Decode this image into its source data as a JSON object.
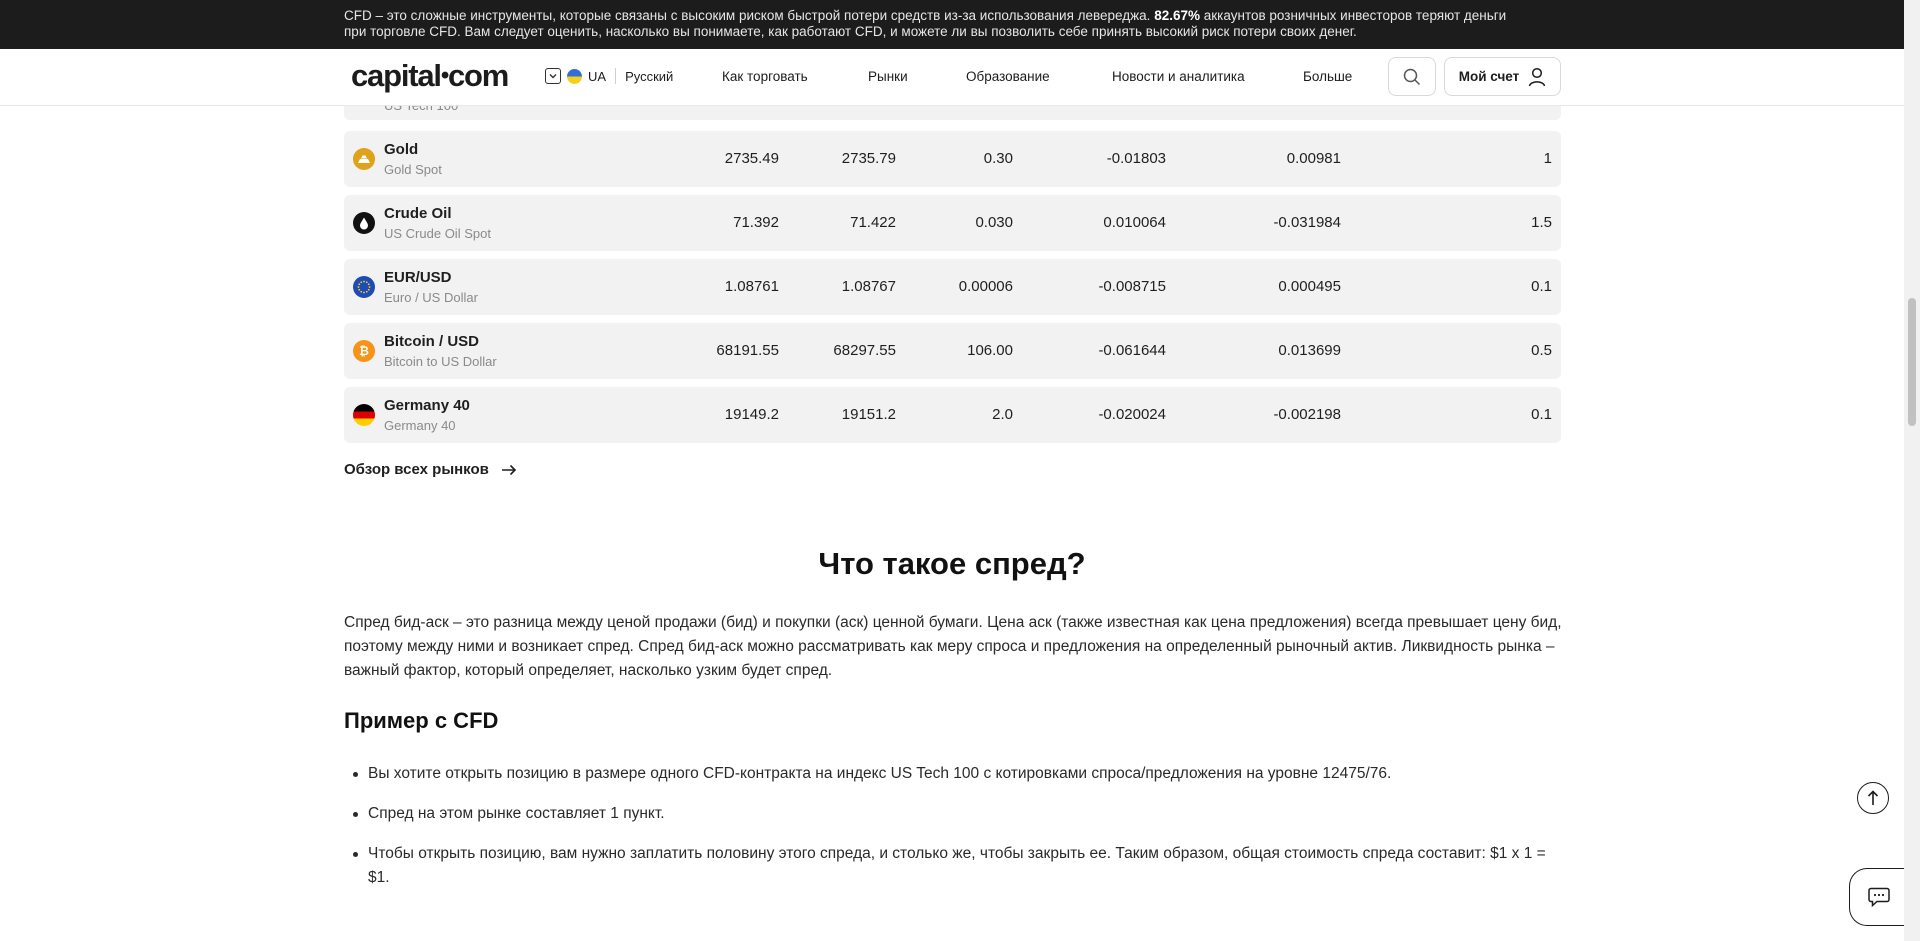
{
  "risk_banner": {
    "text_before": "CFD – это сложные инструменты, которые связаны с высоким риском быстрой потери средств из-за использования левереджа.",
    "percent": "82.67%",
    "text_after": "аккаунтов розничных инвесторов теряют деньги при торговле CFD. Вам следует оценить, насколько вы понимаете, как работают CFD, и можете ли вы позволить себе принять высокий риск потери своих денег."
  },
  "header": {
    "logo_left": "capital",
    "logo_dot": "•",
    "logo_right": "com",
    "country": "UA",
    "language": "Русский",
    "nav": [
      "Как торговать",
      "Рынки",
      "Образование",
      "Новости и аналитика",
      "Больше"
    ],
    "account_label": "Мой счет"
  },
  "markets": {
    "partial_row_sub": "US Tech 100",
    "rows": [
      {
        "name": "Gold",
        "sub": "Gold Spot",
        "sell": "2735.49",
        "buy": "2735.79",
        "spread": "0.30",
        "long": "-0.01803",
        "short": "0.00981",
        "margin": "1",
        "icon_color": "#e0a21b"
      },
      {
        "name": "Crude Oil",
        "sub": "US Crude Oil Spot",
        "sell": "71.392",
        "buy": "71.422",
        "spread": "0.030",
        "long": "0.010064",
        "short": "-0.031984",
        "margin": "1.5",
        "icon_color": "#111111"
      },
      {
        "name": "EUR/USD",
        "sub": "Euro / US Dollar",
        "sell": "1.08761",
        "buy": "1.08767",
        "spread": "0.00006",
        "long": "-0.008715",
        "short": "0.000495",
        "margin": "0.1",
        "icon_color": "#1f4bb5"
      },
      {
        "name": "Bitcoin / USD",
        "sub": "Bitcoin to US Dollar",
        "sell": "68191.55",
        "buy": "68297.55",
        "spread": "106.00",
        "long": "-0.061644",
        "short": "0.013699",
        "margin": "0.5",
        "icon_color": "#f7931a"
      },
      {
        "name": "Germany 40",
        "sub": "Germany 40",
        "sell": "19149.2",
        "buy": "19151.2",
        "spread": "2.0",
        "long": "-0.020024",
        "short": "-0.002198",
        "margin": "0.1",
        "icon_color": "#000000"
      }
    ],
    "overview_link": "Обзор всех рынков"
  },
  "article": {
    "title": "Что такое спред?",
    "paragraph": "Спред бид-аск – это разница между ценой продажи (бид) и покупки (аск) ценной бумаги. Цена аск (также известная как цена предложения) всегда превышает цену бид, поэтому между ними и возникает спред. Спред бид-аск можно рассматривать как меру спроса и предложения на определенный рыночный актив. Ликвидность рынка – важный фактор, который определяет, насколько узким будет спред.",
    "example_title": "Пример с CFD",
    "bullets": [
      "Вы хотите открыть позицию в размере одного CFD-контракта на индекс US Tech 100 с котировками спроса/предложения на уровне 12475/76.",
      "Спред на этом рынке составляет 1 пункт.",
      "Чтобы открыть позицию, вам нужно заплатить половину этого спреда, и столько же, чтобы закрыть ее. Таким образом, общая стоимость спреда составит: $1 x 1 = $1."
    ]
  }
}
